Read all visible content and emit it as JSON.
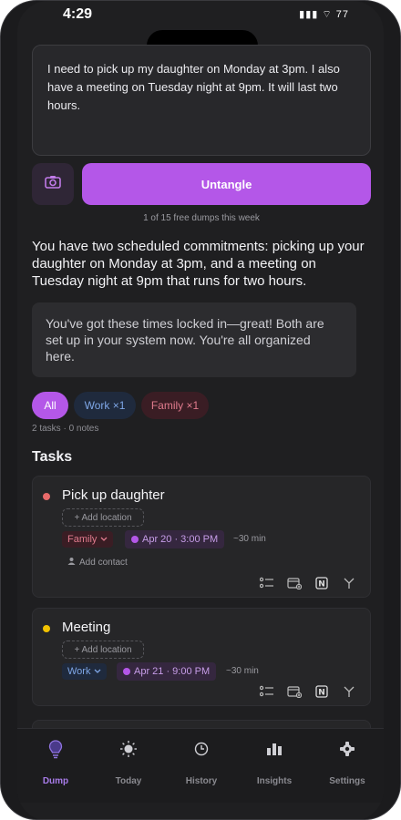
{
  "status": {
    "time": "4:29",
    "icons": "▮▮▮ ⌔ 77"
  },
  "input": {
    "text": "I need to pick up my daughter on Monday at 3pm. I also have a meeting on Tuesday night at 9pm. It will last two hours."
  },
  "actions": {
    "untangle_label": "Untangle",
    "free_count": "1 of 15 free dumps this week"
  },
  "summary": "You have two scheduled commitments: picking up your daughter on Monday at 3pm, and a meeting on Tuesday night at 9pm that runs for two hours.",
  "reply": "You've got these times locked in—great! Both are set up in your system now. You're all organized here.",
  "filters": {
    "all": "All",
    "work": "Work ×1",
    "family": "Family ×1"
  },
  "counts": "2 tasks · 0 notes",
  "section_title": "Tasks",
  "tasks": [
    {
      "title": "Pick up daughter",
      "dot_color": "#e86a6a",
      "add_location": "+ Add location",
      "category": "Family",
      "date": "Apr 20 · 3:00 PM",
      "duration": "~30 min",
      "add_contact": "Add contact"
    },
    {
      "title": "Meeting",
      "dot_color": "#f2c200",
      "add_location": "+ Add location",
      "category": "Work",
      "date": "Apr 21 · 9:00 PM",
      "duration": "~30 min"
    }
  ],
  "tabs": [
    {
      "label": "Dump",
      "icon": "bulb-icon",
      "active": true
    },
    {
      "label": "Today",
      "icon": "sun-icon"
    },
    {
      "label": "History",
      "icon": "clock-icon"
    },
    {
      "label": "Insights",
      "icon": "bar-chart-icon"
    },
    {
      "label": "Settings",
      "icon": "gear-icon"
    }
  ],
  "colors": {
    "accent": "#b457e8",
    "background": "#1f1f21",
    "card": "#262628"
  }
}
